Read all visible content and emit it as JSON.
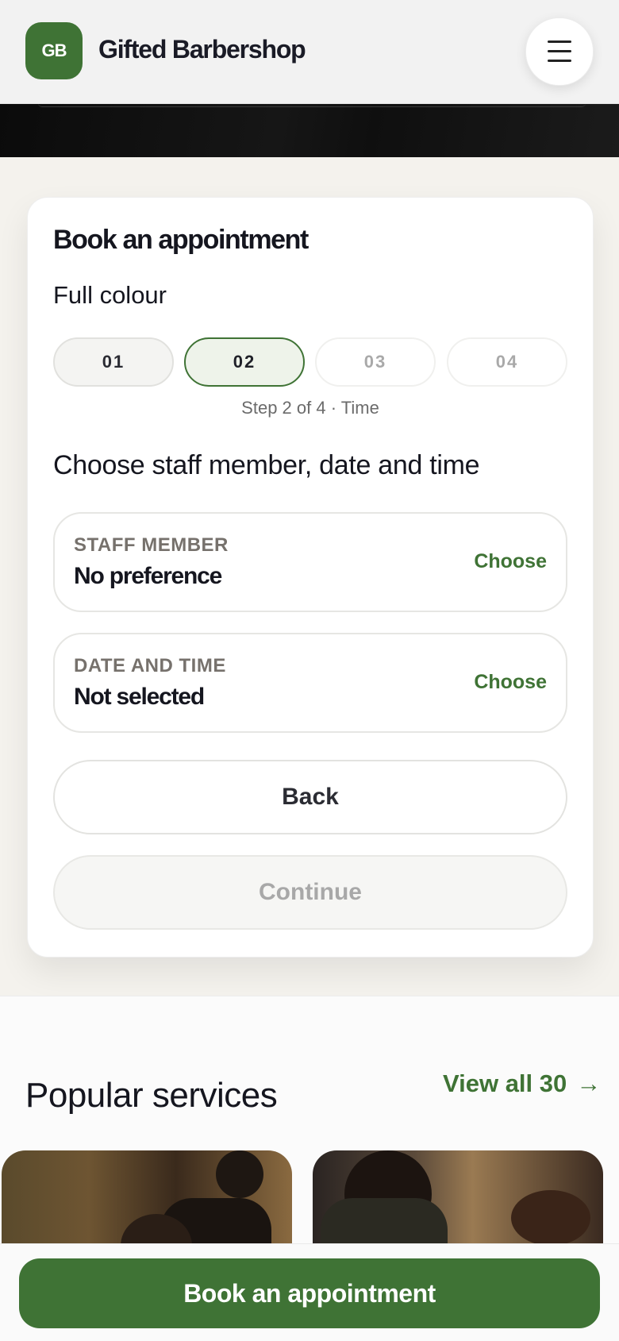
{
  "header": {
    "logo_text": "GB",
    "brand": "Gifted Barbershop",
    "menu_icon": "hamburger-menu-icon"
  },
  "booking": {
    "title": "Book an appointment",
    "service": "Full colour",
    "steps": [
      "01",
      "02",
      "03",
      "04"
    ],
    "current_step": 2,
    "step_caption": "Step 2 of 4 · Time",
    "section_title": "Choose staff member, date and time",
    "staff": {
      "label": "STAFF MEMBER",
      "value": "No preference",
      "action": "Choose"
    },
    "datetime": {
      "label": "DATE AND TIME",
      "value": "Not selected",
      "action": "Choose"
    },
    "back_label": "Back",
    "continue_label": "Continue"
  },
  "popular": {
    "title": "Popular services",
    "view_all": "View all 30",
    "arrow": "→"
  },
  "cta": {
    "label": "Book an appointment"
  },
  "colors": {
    "accent": "#3f7335",
    "background": "#f4f2ed"
  }
}
